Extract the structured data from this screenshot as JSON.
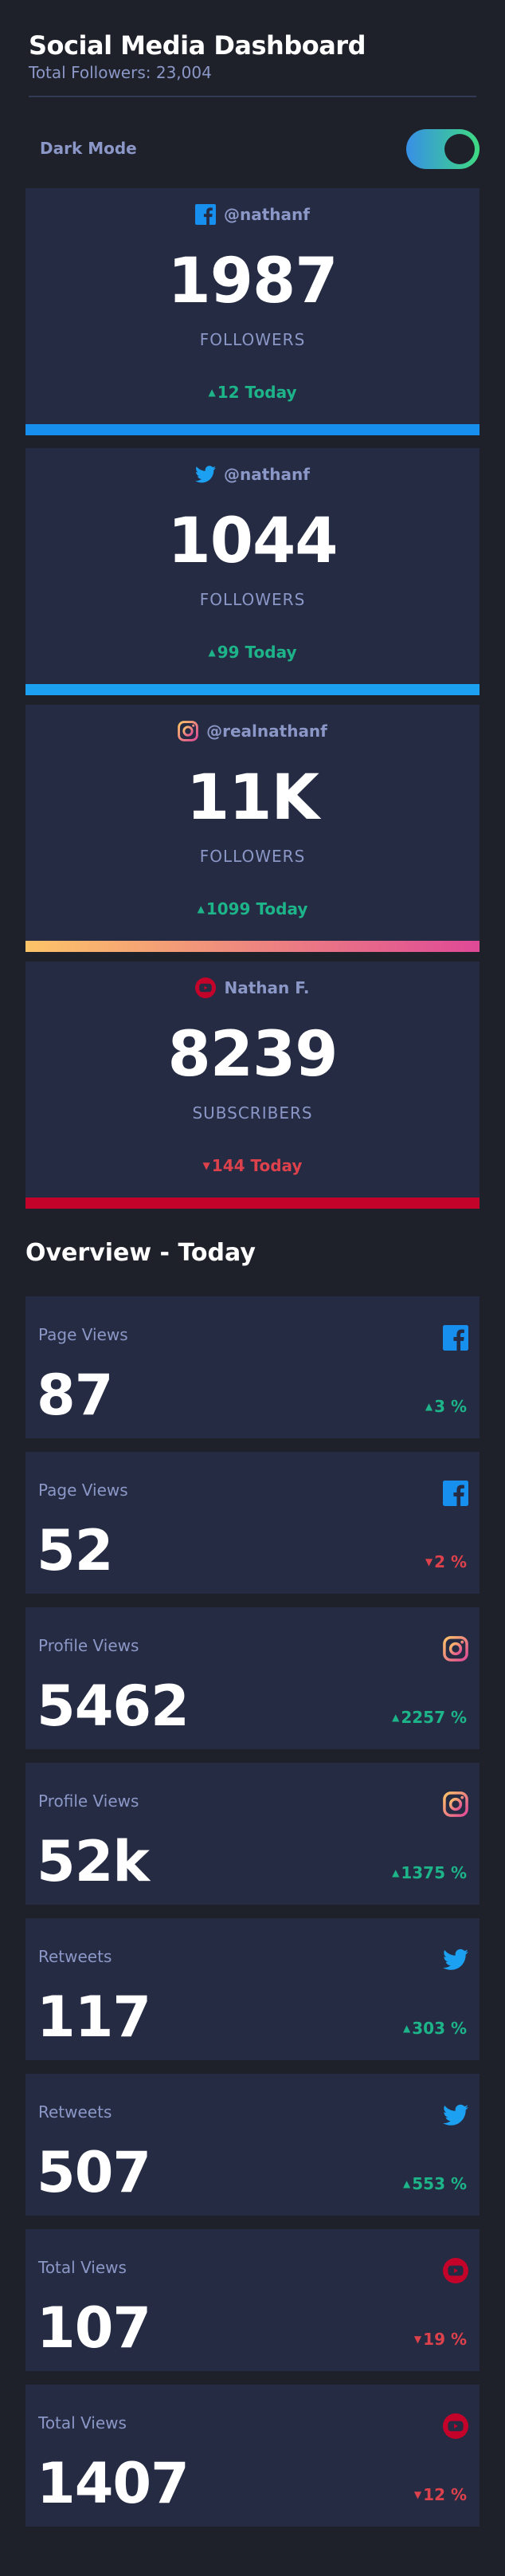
{
  "header": {
    "title": "Social Media Dashboard",
    "subtitle": "Total Followers: 23,004"
  },
  "mode": {
    "label": "Dark Mode"
  },
  "cards": [
    {
      "platform": "facebook",
      "icon": "facebook-icon",
      "handle": "@nathanf",
      "count": "1987",
      "unit": "FOLLOWERS",
      "change": "12 Today",
      "direction": "up",
      "accent": "#178fef"
    },
    {
      "platform": "twitter",
      "icon": "twitter-icon",
      "handle": "@nathanf",
      "count": "1044",
      "unit": "FOLLOWERS",
      "change": "99 Today",
      "direction": "up",
      "accent": "#1ca0f2"
    },
    {
      "platform": "instagram",
      "icon": "instagram-icon",
      "handle": "@realnathanf",
      "count": "11K",
      "unit": "FOLLOWERS",
      "change": "1099 Today",
      "direction": "up",
      "accent": "instagram-gradient"
    },
    {
      "platform": "youtube",
      "icon": "youtube-icon",
      "handle": "Nathan F.",
      "count": "8239",
      "unit": "SUBSCRIBERS",
      "change": "144 Today",
      "direction": "down",
      "accent": "#c4032a"
    }
  ],
  "overview": {
    "title": "Overview - Today",
    "items": [
      {
        "label": "Page Views",
        "icon": "facebook-icon",
        "value": "87",
        "change": "3 %",
        "direction": "up"
      },
      {
        "label": "Page Views",
        "icon": "facebook-icon",
        "value": "52",
        "change": "2 %",
        "direction": "down"
      },
      {
        "label": "Profile Views",
        "icon": "instagram-icon",
        "value": "5462",
        "change": "2257 %",
        "direction": "up"
      },
      {
        "label": "Profile Views",
        "icon": "instagram-icon",
        "value": "52k",
        "change": "1375 %",
        "direction": "up"
      },
      {
        "label": "Retweets",
        "icon": "twitter-icon",
        "value": "117",
        "change": "303 %",
        "direction": "up"
      },
      {
        "label": "Retweets",
        "icon": "twitter-icon",
        "value": "507",
        "change": "553 %",
        "direction": "up"
      },
      {
        "label": "Total Views",
        "icon": "youtube-icon",
        "value": "107",
        "change": "19 %",
        "direction": "down"
      },
      {
        "label": "Total Views",
        "icon": "youtube-icon",
        "value": "1407",
        "change": "12 %",
        "direction": "down"
      }
    ]
  },
  "colors": {
    "up": "#1db489",
    "down": "#dc414c",
    "facebook": "#178fef",
    "twitter": "#1ca0f2",
    "youtube": "#c4032a"
  }
}
